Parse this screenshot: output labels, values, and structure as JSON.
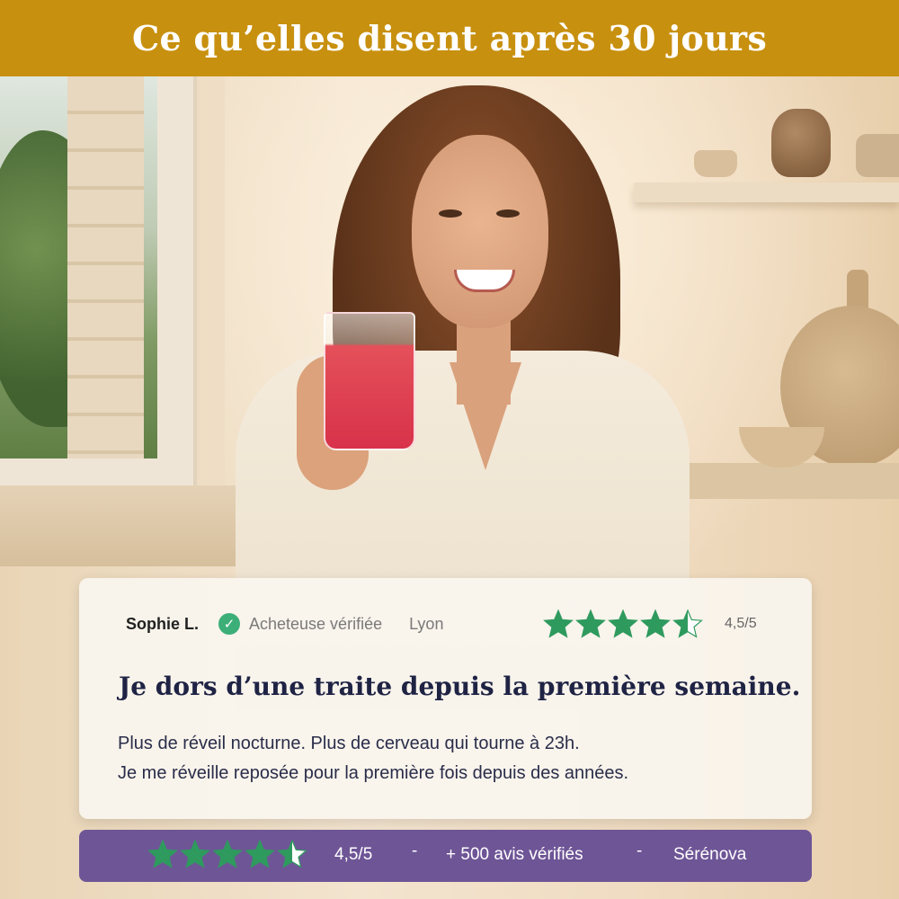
{
  "header": {
    "title": "Ce qu’elles disent après 30 jours"
  },
  "review": {
    "name": "Sophie L.",
    "verified_label": "Acheteuse vérifiée",
    "city": "Lyon",
    "rating": 4.5,
    "rating_text": "4,5/5",
    "title": "Je dors d’une traite depuis la première semaine.",
    "body_line1": "Plus de réveil nocturne. Plus de cerveau qui tourne à 23h.",
    "body_line2": "Je me réveille reposée pour la première fois depuis des années."
  },
  "summary_bar": {
    "rating": 4.5,
    "rating_text": "4,5/5",
    "separator": "-",
    "reviews_count": "+ 500 avis vérifiés",
    "brand": "Sérénova"
  },
  "colors": {
    "header_bg": "#c8900f",
    "star_green": "#2f9a5e",
    "verified_green": "#3cae78",
    "bar_purple": "#6e5596",
    "title_navy": "#1f2344"
  }
}
